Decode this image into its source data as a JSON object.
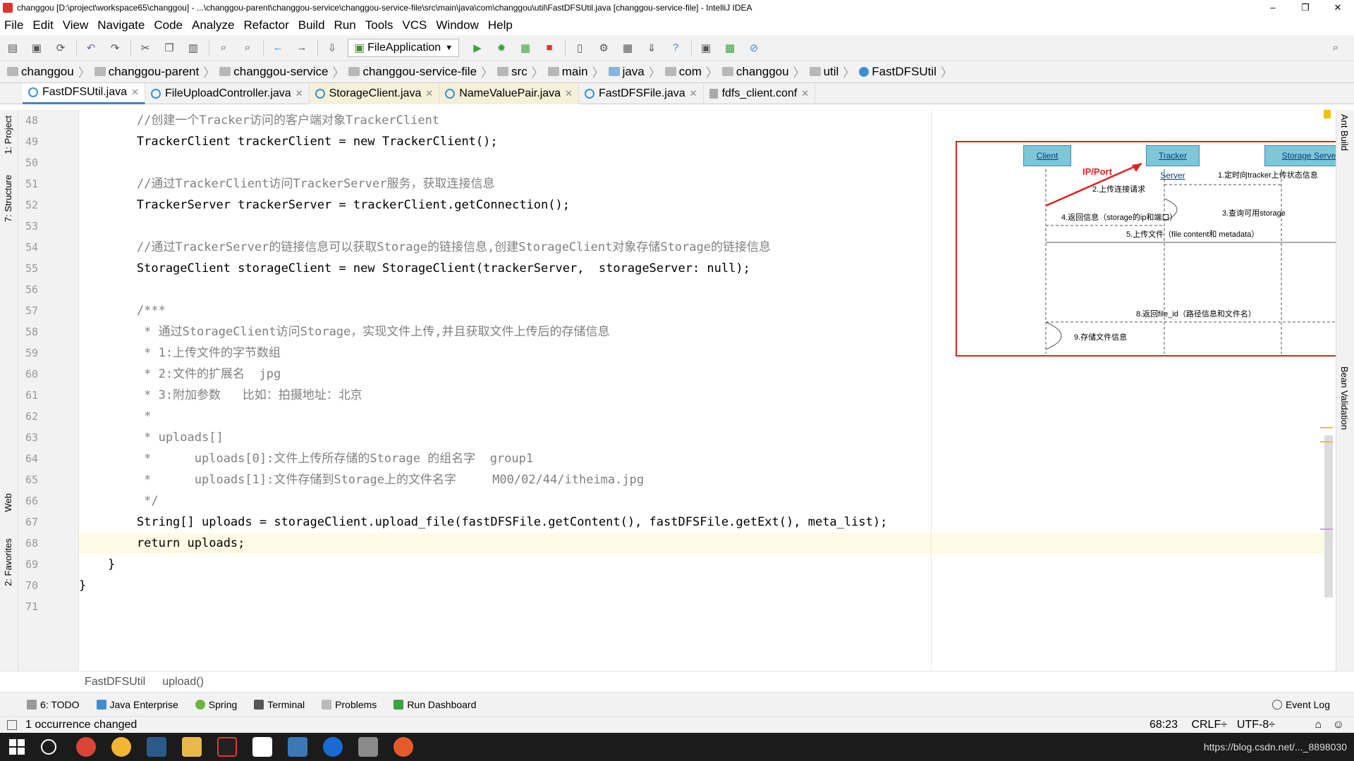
{
  "window": {
    "title": "changgou [D:\\project\\workspace65\\changgou] - ...\\changgou-parent\\changgou-service\\changgou-service-file\\src\\main\\java\\com\\changgou\\util\\FastDFSUtil.java [changgou-service-file] - IntelliJ IDEA",
    "controls": [
      "–",
      "❐",
      "✕"
    ]
  },
  "menu": [
    "File",
    "Edit",
    "View",
    "Navigate",
    "Code",
    "Analyze",
    "Refactor",
    "Build",
    "Run",
    "Tools",
    "VCS",
    "Window",
    "Help"
  ],
  "toolbar": {
    "run_config": "FileApplication"
  },
  "breadcrumbs": [
    "changgou",
    "changgou-parent",
    "changgou-service",
    "changgou-service-file",
    "src",
    "main",
    "java",
    "com",
    "changgou",
    "util",
    "FastDFSUtil"
  ],
  "tabs": [
    {
      "label": "FastDFSUtil.java",
      "active": true
    },
    {
      "label": "FileUploadController.java",
      "active": false
    },
    {
      "label": "StorageClient.java",
      "active": false
    },
    {
      "label": "NameValuePair.java",
      "active": false
    },
    {
      "label": "FastDFSFile.java",
      "active": false
    },
    {
      "label": "fdfs_client.conf",
      "active": false
    }
  ],
  "left_tools": [
    "1: Project",
    "7: Structure",
    "Web",
    "2: Favorites"
  ],
  "right_tools": [
    "Ant Build",
    "Bean Validation"
  ],
  "editor": {
    "lines": [
      {
        "n": "48",
        "text": "        //创建一个Tracker访问的客户端对象TrackerClient",
        "type": "comment"
      },
      {
        "n": "49",
        "text": "        TrackerClient trackerClient = new TrackerClient();",
        "type": "code"
      },
      {
        "n": "50",
        "text": "",
        "type": "code"
      },
      {
        "n": "51",
        "text": "        //通过TrackerClient访问TrackerServer服务，获取连接信息",
        "type": "comment"
      },
      {
        "n": "52",
        "text": "        TrackerServer trackerServer = trackerClient.getConnection();",
        "type": "code"
      },
      {
        "n": "53",
        "text": "",
        "type": "code"
      },
      {
        "n": "54",
        "text": "        //通过TrackerServer的链接信息可以获取Storage的链接信息,创建StorageClient对象存储Storage的链接信息",
        "type": "comment"
      },
      {
        "n": "55",
        "text": "        StorageClient storageClient = new StorageClient(trackerServer,  storageServer: null);",
        "type": "code"
      },
      {
        "n": "56",
        "text": "",
        "type": "code"
      },
      {
        "n": "57",
        "text": "        /***",
        "type": "comment"
      },
      {
        "n": "58",
        "text": "         * 通过StorageClient访问Storage，实现文件上传,并且获取文件上传后的存储信息",
        "type": "comment"
      },
      {
        "n": "59",
        "text": "         * 1:上传文件的字节数组",
        "type": "comment"
      },
      {
        "n": "60",
        "text": "         * 2:文件的扩展名  jpg",
        "type": "comment"
      },
      {
        "n": "61",
        "text": "         * 3:附加参数   比如：拍摄地址：北京",
        "type": "comment"
      },
      {
        "n": "62",
        "text": "         *",
        "type": "comment"
      },
      {
        "n": "63",
        "text": "         * uploads[]",
        "type": "comment"
      },
      {
        "n": "64",
        "text": "         *      uploads[0]:文件上传所存储的Storage 的组名字  group1",
        "type": "comment"
      },
      {
        "n": "65",
        "text": "         *      uploads[1]:文件存储到Storage上的文件名字     M00/02/44/itheima.jpg",
        "type": "comment"
      },
      {
        "n": "66",
        "text": "         */",
        "type": "comment"
      },
      {
        "n": "67",
        "text": "        String[] uploads = storageClient.upload_file(fastDFSFile.getContent(), fastDFSFile.getExt(), meta_list);",
        "type": "code"
      },
      {
        "n": "68",
        "text": "        return uploads;",
        "type": "code"
      },
      {
        "n": "69",
        "text": "    }",
        "type": "code"
      },
      {
        "n": "70",
        "text": "}",
        "type": "code"
      },
      {
        "n": "71",
        "text": "",
        "type": "code"
      }
    ],
    "current_line": "68"
  },
  "diagram": {
    "client": "Client",
    "tracker": "Tracker Server",
    "storage": "Storage Server",
    "ipport": "IP/Port",
    "m1": "1.定时向tracker上传状态信息",
    "m2": "2.上传连接请求",
    "m3": "3.查询可用storage",
    "m4": "4.返回信息（storage的ip和端口）",
    "m5": "5.上传文件（file content和 metadata）",
    "m8": "8.返回file_id（路径信息和文件名）",
    "m9": "9.存储文件信息"
  },
  "navbar": [
    "FastDFSUtil",
    "upload()"
  ],
  "toolwindows": [
    "6: TODO",
    "Java Enterprise",
    "Spring",
    "Terminal",
    "Problems",
    "Run Dashboard",
    "Event Log"
  ],
  "status": {
    "message": "1 occurrence changed",
    "position": "68:23",
    "line_sep": "CRLF÷",
    "encoding": "UTF-8÷"
  },
  "taskbar": {
    "watermark": "https://blog.csdn.net/..._8898030"
  },
  "colors": {
    "keyword": "#000080",
    "comment": "#808080",
    "current_line": "#fffae3",
    "diagram_border": "#d22222",
    "arrow_red": "#e02020"
  }
}
